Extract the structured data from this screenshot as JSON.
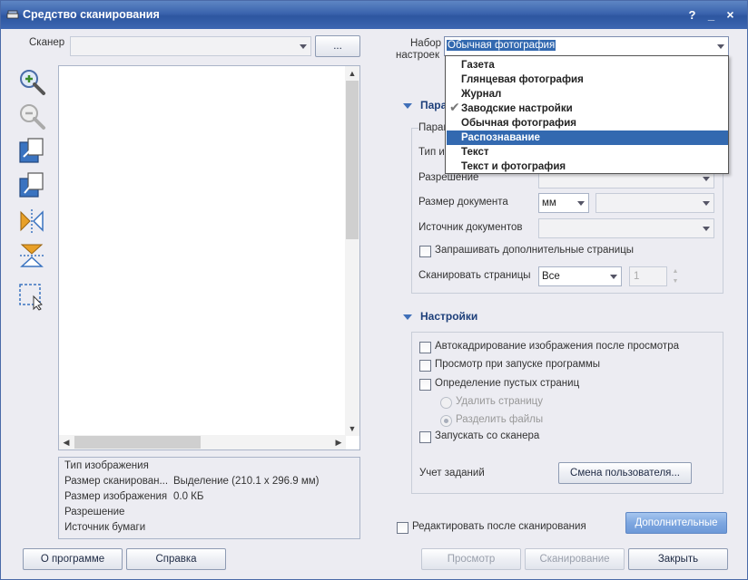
{
  "window": {
    "title": "Средство сканирования"
  },
  "scanner": {
    "label": "Сканер",
    "value": "",
    "browse_label": "..."
  },
  "preset": {
    "label_line1": "Набор",
    "label_line2": "настроек",
    "value": "Обычная фотография",
    "options": [
      "Газета",
      "Глянцевая фотография",
      "Журнал",
      "Заводские настройки",
      "Обычная фотография",
      "Распознавание",
      "Текст",
      "Текст и фотография"
    ],
    "highlighted": "Распознавание",
    "checked": "Заводские настройки"
  },
  "params": {
    "header": "Пара",
    "group_label": "Парам",
    "image_type_label": "Тип из",
    "resolution_label": "Разрешение",
    "doc_size_label": "Размер документа",
    "doc_size_unit": "мм",
    "doc_source_label": "Источник документов",
    "ask_more_pages_label": "Запрашивать дополнительные страницы",
    "scan_pages_label": "Сканировать страницы",
    "scan_pages_value": "Все",
    "pages_count": "1"
  },
  "settings": {
    "header": "Настройки",
    "autocrop_label": "Автокадрирование изображения после просмотра",
    "preview_on_start_label": "Просмотр при запуске программы",
    "blank_detect_label": "Определение пустых страниц",
    "delete_page_label": "Удалить страницу",
    "split_files_label": "Разделить файлы",
    "run_from_scanner_label": "Запускать со сканера",
    "job_accounting_label": "Учет заданий",
    "change_user_label": "Смена пользователя..."
  },
  "info": {
    "rows": [
      {
        "label": "Тип изображения",
        "value": ""
      },
      {
        "label": "Размер сканирован...",
        "value": "Выделение (210.1 x 296.9 мм)"
      },
      {
        "label": "Размер изображения",
        "value": "0.0 КБ"
      },
      {
        "label": "Разрешение",
        "value": ""
      },
      {
        "label": "Источник бумаги",
        "value": ""
      }
    ]
  },
  "footer": {
    "edit_after_scan_label": "Редактировать после сканирования",
    "advanced_label": "Дополнительные",
    "about_label": "О программе",
    "help_label": "Справка",
    "preview_label": "Просмотр",
    "scan_label": "Сканирование",
    "close_label": "Закрыть"
  },
  "colors": {
    "accent": "#3369b0",
    "titlebar": "#3a63ad",
    "background": "#ececf2"
  }
}
